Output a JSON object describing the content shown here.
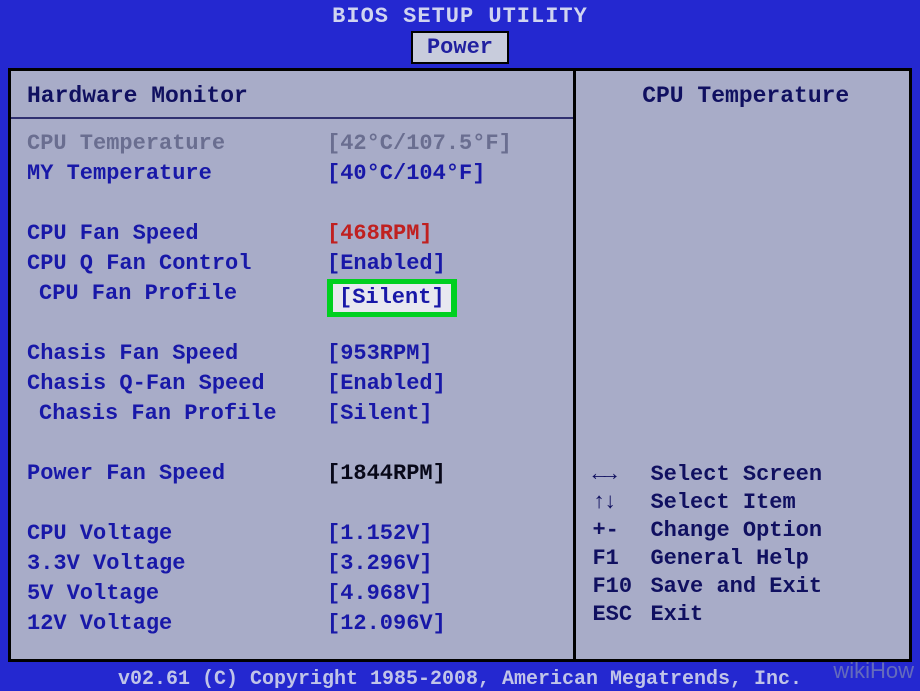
{
  "header": {
    "title": "BIOS SETUP UTILITY"
  },
  "tab": {
    "label": "Power"
  },
  "left": {
    "title": "Hardware Monitor",
    "rows": {
      "cpu_temp_label": "CPU Temperature",
      "cpu_temp_value": "[42°C/107.5°F]",
      "my_temp_label": "MY Temperature",
      "my_temp_value": "[40°C/104°F]",
      "cpu_fan_speed_label": "CPU Fan Speed",
      "cpu_fan_speed_value": "[468RPM]",
      "cpu_q_fan_label": "CPU Q Fan Control",
      "cpu_q_fan_value": "[Enabled]",
      "cpu_fan_profile_label": "CPU Fan Profile",
      "cpu_fan_profile_value": "[Silent]",
      "chasis_fan_speed_label": "Chasis Fan Speed",
      "chasis_fan_speed_value": "[953RPM]",
      "chasis_q_fan_label": "Chasis Q-Fan Speed",
      "chasis_q_fan_value": "[Enabled]",
      "chasis_fan_profile_label": "Chasis Fan Profile",
      "chasis_fan_profile_value": "[Silent]",
      "power_fan_speed_label": "Power Fan Speed",
      "power_fan_speed_value": "[1844RPM]",
      "cpu_voltage_label": "CPU Voltage",
      "cpu_voltage_value": "[1.152V]",
      "v33_label": "3.3V Voltage",
      "v33_value": "[3.296V]",
      "v5_label": "5V Voltage",
      "v5_value": "[4.968V]",
      "v12_label": "12V Voltage",
      "v12_value": "[12.096V]"
    }
  },
  "right": {
    "title": "CPU Temperature",
    "help": {
      "select_screen_key": "←→",
      "select_screen": "Select Screen",
      "select_item_key": "↑↓",
      "select_item": "Select Item",
      "change_option_key": "+-",
      "change_option": "Change Option",
      "general_help_key": "F1",
      "general_help": "General Help",
      "save_exit_key": "F10",
      "save_exit": "Save and Exit",
      "exit_key": "ESC",
      "exit": "Exit"
    }
  },
  "footer": {
    "text": "v02.61 (C) Copyright 1985-2008, American Megatrends, Inc."
  },
  "watermark": "wikiHow"
}
